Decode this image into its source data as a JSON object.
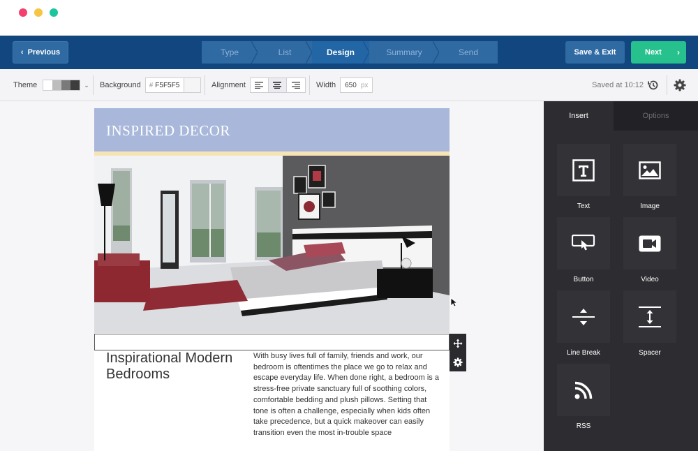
{
  "window": {
    "traffic_lights": [
      "#f4406e",
      "#f6c543",
      "#1dc59f"
    ]
  },
  "topbar": {
    "previous_label": "Previous",
    "steps": [
      {
        "label": "Type",
        "active": false
      },
      {
        "label": "List",
        "active": false
      },
      {
        "label": "Design",
        "active": true
      },
      {
        "label": "Summary",
        "active": false
      },
      {
        "label": "Send",
        "active": false
      }
    ],
    "save_exit_label": "Save & Exit",
    "next_label": "Next"
  },
  "toolbar": {
    "theme_label": "Theme",
    "theme_colors": [
      "#ffffff",
      "#bdbdbd",
      "#7a7a7a",
      "#3d3d3d"
    ],
    "background_label": "Background",
    "background_hash": "#",
    "background_value": "F5F5F5",
    "alignment_label": "Alignment",
    "alignment_selected": "center",
    "width_label": "Width",
    "width_value": "650",
    "width_unit": "px",
    "saved_status": "Saved at 10:12"
  },
  "email": {
    "header_title": "INSPIRED DECOR",
    "header_color": "#a8b7da",
    "article_title": "Inspirational Modern Bedrooms",
    "article_body": "With busy lives full of family, friends and work, our bedroom is oftentimes the place we go to relax and escape everyday life. When done right, a bedroom is a stress-free private sanctuary full of soothing colors, comfortable bedding and plush pillows. Setting that tone is often a challenge, especially when kids often take precedence, but a quick makeover can easily transition even the most in-trouble space"
  },
  "panel": {
    "tabs": [
      {
        "label": "Insert",
        "active": true
      },
      {
        "label": "Options",
        "active": false
      }
    ],
    "items": [
      {
        "label": "Text",
        "icon": "text-icon"
      },
      {
        "label": "Image",
        "icon": "image-icon"
      },
      {
        "label": "Button",
        "icon": "button-icon"
      },
      {
        "label": "Video",
        "icon": "video-icon"
      },
      {
        "label": "Line Break",
        "icon": "line-break-icon"
      },
      {
        "label": "Spacer",
        "icon": "spacer-icon"
      },
      {
        "label": "RSS",
        "icon": "rss-icon"
      }
    ]
  }
}
